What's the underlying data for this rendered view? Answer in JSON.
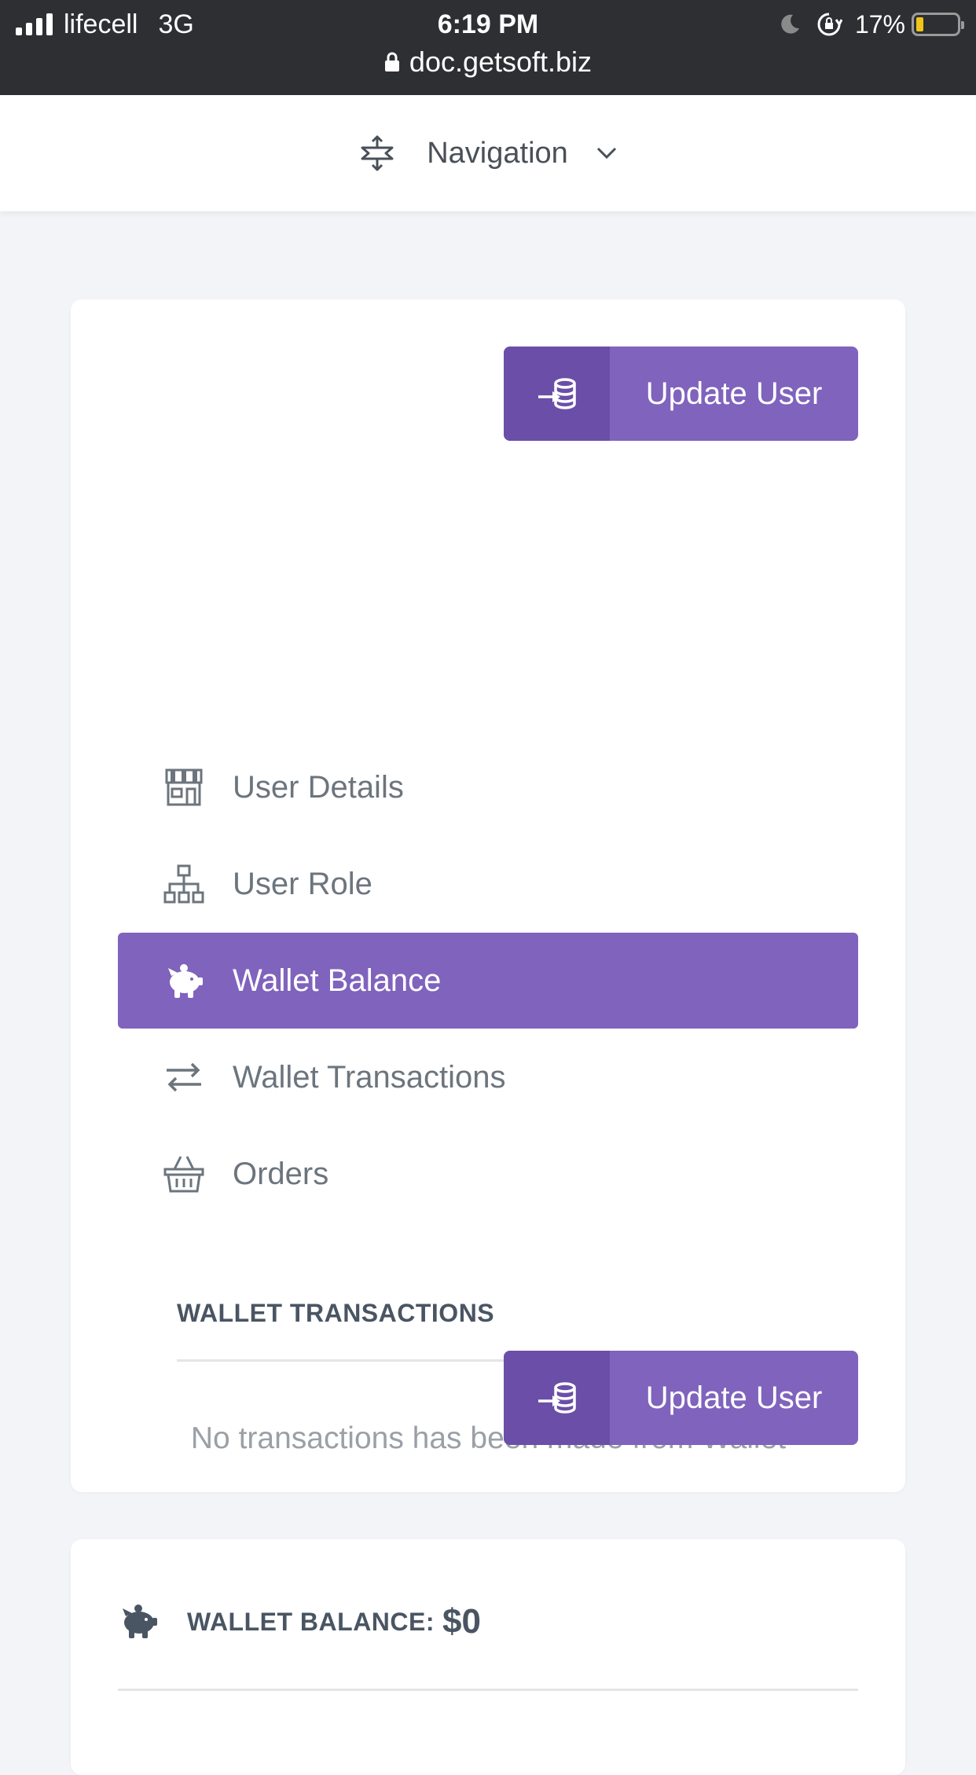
{
  "status_bar": {
    "carrier": "lifecell",
    "network": "3G",
    "time": "6:19 PM",
    "battery": "17%",
    "battery_level": 0.17,
    "url": "doc.getsoft.biz"
  },
  "navbar": {
    "label": "Navigation",
    "icon": "navigation-arrows-icon"
  },
  "actions": {
    "update_user_label": "Update User",
    "update_user_icon": "database-import-icon"
  },
  "menu": {
    "items": [
      {
        "label": "User Details",
        "icon": "store-icon",
        "active": false
      },
      {
        "label": "User Role",
        "icon": "sitemap-icon",
        "active": false
      },
      {
        "label": "Wallet Balance",
        "icon": "piggy-bank-icon",
        "active": true
      },
      {
        "label": "Wallet Transactions",
        "icon": "exchange-arrows-icon",
        "active": false
      },
      {
        "label": "Orders",
        "icon": "basket-icon",
        "active": false
      }
    ]
  },
  "wallet_transactions": {
    "title": "WALLET TRANSACTIONS",
    "empty_message": "No transactions has been made from Wallet"
  },
  "wallet_balance": {
    "label": "WALLET BALANCE:",
    "value": "$0",
    "icon": "piggy-bank-icon"
  },
  "colors": {
    "accent": "#7f63bd",
    "accent_dark": "#6b4ea8",
    "status_bar_bg": "#2d2f33",
    "page_bg": "#f3f4f7",
    "text_muted": "#6c757d"
  }
}
